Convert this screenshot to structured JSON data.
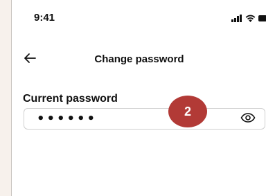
{
  "status_bar": {
    "time": "9:41",
    "icons": [
      "cellular-signal-icon",
      "wifi-icon",
      "battery-icon"
    ]
  },
  "nav": {
    "back_icon": "arrow-left-icon",
    "title": "Change password"
  },
  "form": {
    "current_password_label": "Current password",
    "current_password_value": "••••••",
    "visibility_icon": "eye-icon"
  },
  "annotation": {
    "step_number": "2",
    "color": "#b23a36"
  }
}
